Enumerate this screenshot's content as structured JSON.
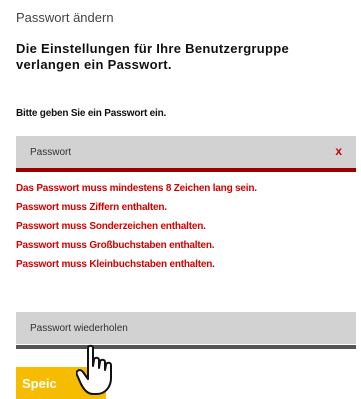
{
  "dialog": {
    "title": "Passwort ändern",
    "heading": "Die Einstellungen für Ihre Benutzergruppe verlangen ein Passwort.",
    "prompt": "Bitte geben Sie ein Passwort ein."
  },
  "password_field": {
    "placeholder": "Passwort",
    "clear_label": "x"
  },
  "errors": [
    "Das Passwort muss mindestens 8 Zeichen lang sein.",
    "Passwort muss Ziffern enthalten.",
    "Passwort muss Sonderzeichen enthalten.",
    "Passwort muss Großbuchstaben enthalten.",
    "Passwort muss Kleinbuchstaben enthalten."
  ],
  "repeat_field": {
    "placeholder": "Passwort wiederholen"
  },
  "save_button": {
    "label": "Speic"
  },
  "colors": {
    "error": "#d40000",
    "button": "#f6bc00",
    "field": "#d2d2d2"
  },
  "icons": {
    "cursor": "hand-pointer-icon"
  }
}
